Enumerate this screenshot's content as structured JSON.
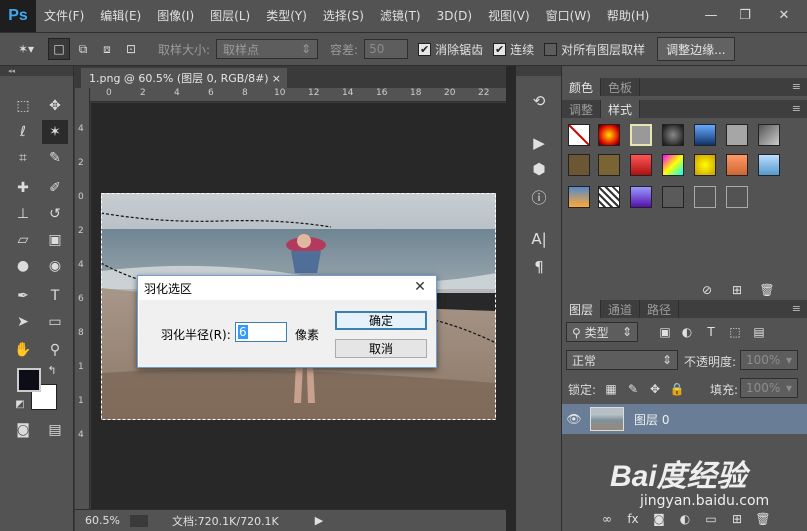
{
  "menubar": {
    "logo": "Ps",
    "items": [
      "文件(F)",
      "编辑(E)",
      "图像(I)",
      "图层(L)",
      "类型(Y)",
      "选择(S)",
      "滤镜(T)",
      "3D(D)",
      "视图(V)",
      "窗口(W)",
      "帮助(H)"
    ],
    "minimize": "—",
    "restore": "❐",
    "close": "✕"
  },
  "options": {
    "sample_size_label": "取样大小:",
    "sample_size_value": "取样点",
    "tolerance_label": "容差:",
    "tolerance_value": "50",
    "antialias_label": "消除锯齿",
    "contiguous_label": "连续",
    "sample_all_label": "对所有图层取样",
    "refine_edge_label": "调整边缘..."
  },
  "document": {
    "tab_title": "1.png @ 60.5% (图层 0, RGB/8#)",
    "tab_close": "×",
    "ruler_h_ticks": [
      "0",
      "2",
      "4",
      "6",
      "8",
      "10",
      "12",
      "14",
      "16",
      "18",
      "20",
      "22"
    ],
    "ruler_v_ticks": [
      "4",
      "2",
      "0",
      "2",
      "4",
      "6",
      "8",
      "1",
      "1",
      "4"
    ],
    "zoom": "60.5%",
    "doc_info": "文档:720.1K/720.1K"
  },
  "dialog": {
    "title": "羽化选区",
    "close": "✕",
    "radius_label": "羽化半径(R):",
    "radius_value": "6",
    "unit": "像素",
    "ok": "确定",
    "cancel": "取消"
  },
  "panels": {
    "color_tabs": [
      "颜色",
      "色板"
    ],
    "style_tabs": [
      "调整",
      "样式"
    ],
    "layers_tabs": [
      "图层",
      "通道",
      "路径"
    ],
    "filter_kind": "类型",
    "blend_mode": "正常",
    "opacity_label": "不透明度:",
    "opacity_value": "100%",
    "lock_label": "锁定:",
    "fill_label": "填充:",
    "fill_value": "100%",
    "layer_name": "图层 0"
  },
  "watermark": {
    "logo": "Bai度经验",
    "url": "jingyan.baidu.com"
  }
}
